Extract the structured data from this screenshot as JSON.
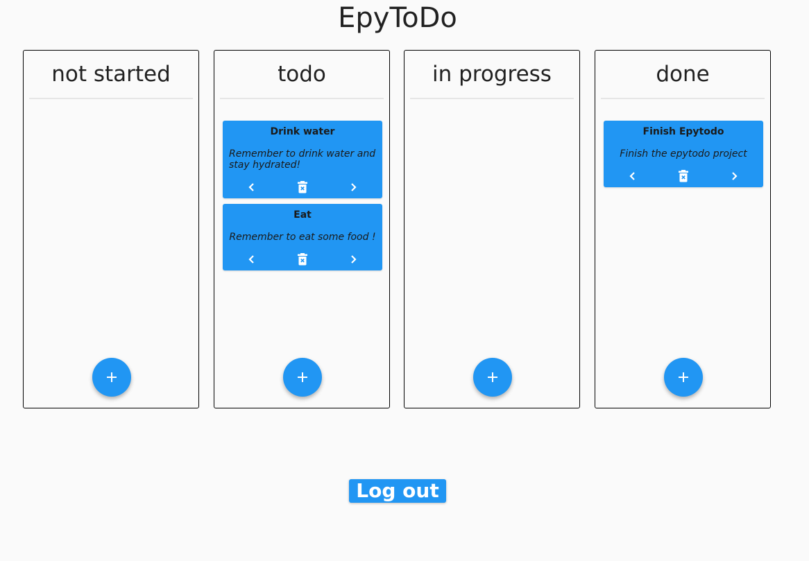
{
  "app": {
    "title": "EpyToDo"
  },
  "colors": {
    "accent": "#2196f3",
    "background": "#fafafa",
    "text": "#212121",
    "icon": "#ffffff"
  },
  "icons": {
    "prev": "chevron-left-icon",
    "delete": "trash-icon",
    "next": "chevron-right-icon",
    "add": "plus-icon"
  },
  "columns": [
    {
      "title": "not started",
      "tasks": []
    },
    {
      "title": "todo",
      "tasks": [
        {
          "title": "Drink water",
          "description": "Remember to drink water and stay hydrated!"
        },
        {
          "title": "Eat",
          "description": "Remember to eat some food !"
        }
      ]
    },
    {
      "title": "in progress",
      "tasks": []
    },
    {
      "title": "done",
      "tasks": [
        {
          "title": "Finish Epytodo",
          "description": "Finish the epytodo project"
        }
      ]
    }
  ],
  "logout": {
    "label": "Log out"
  }
}
